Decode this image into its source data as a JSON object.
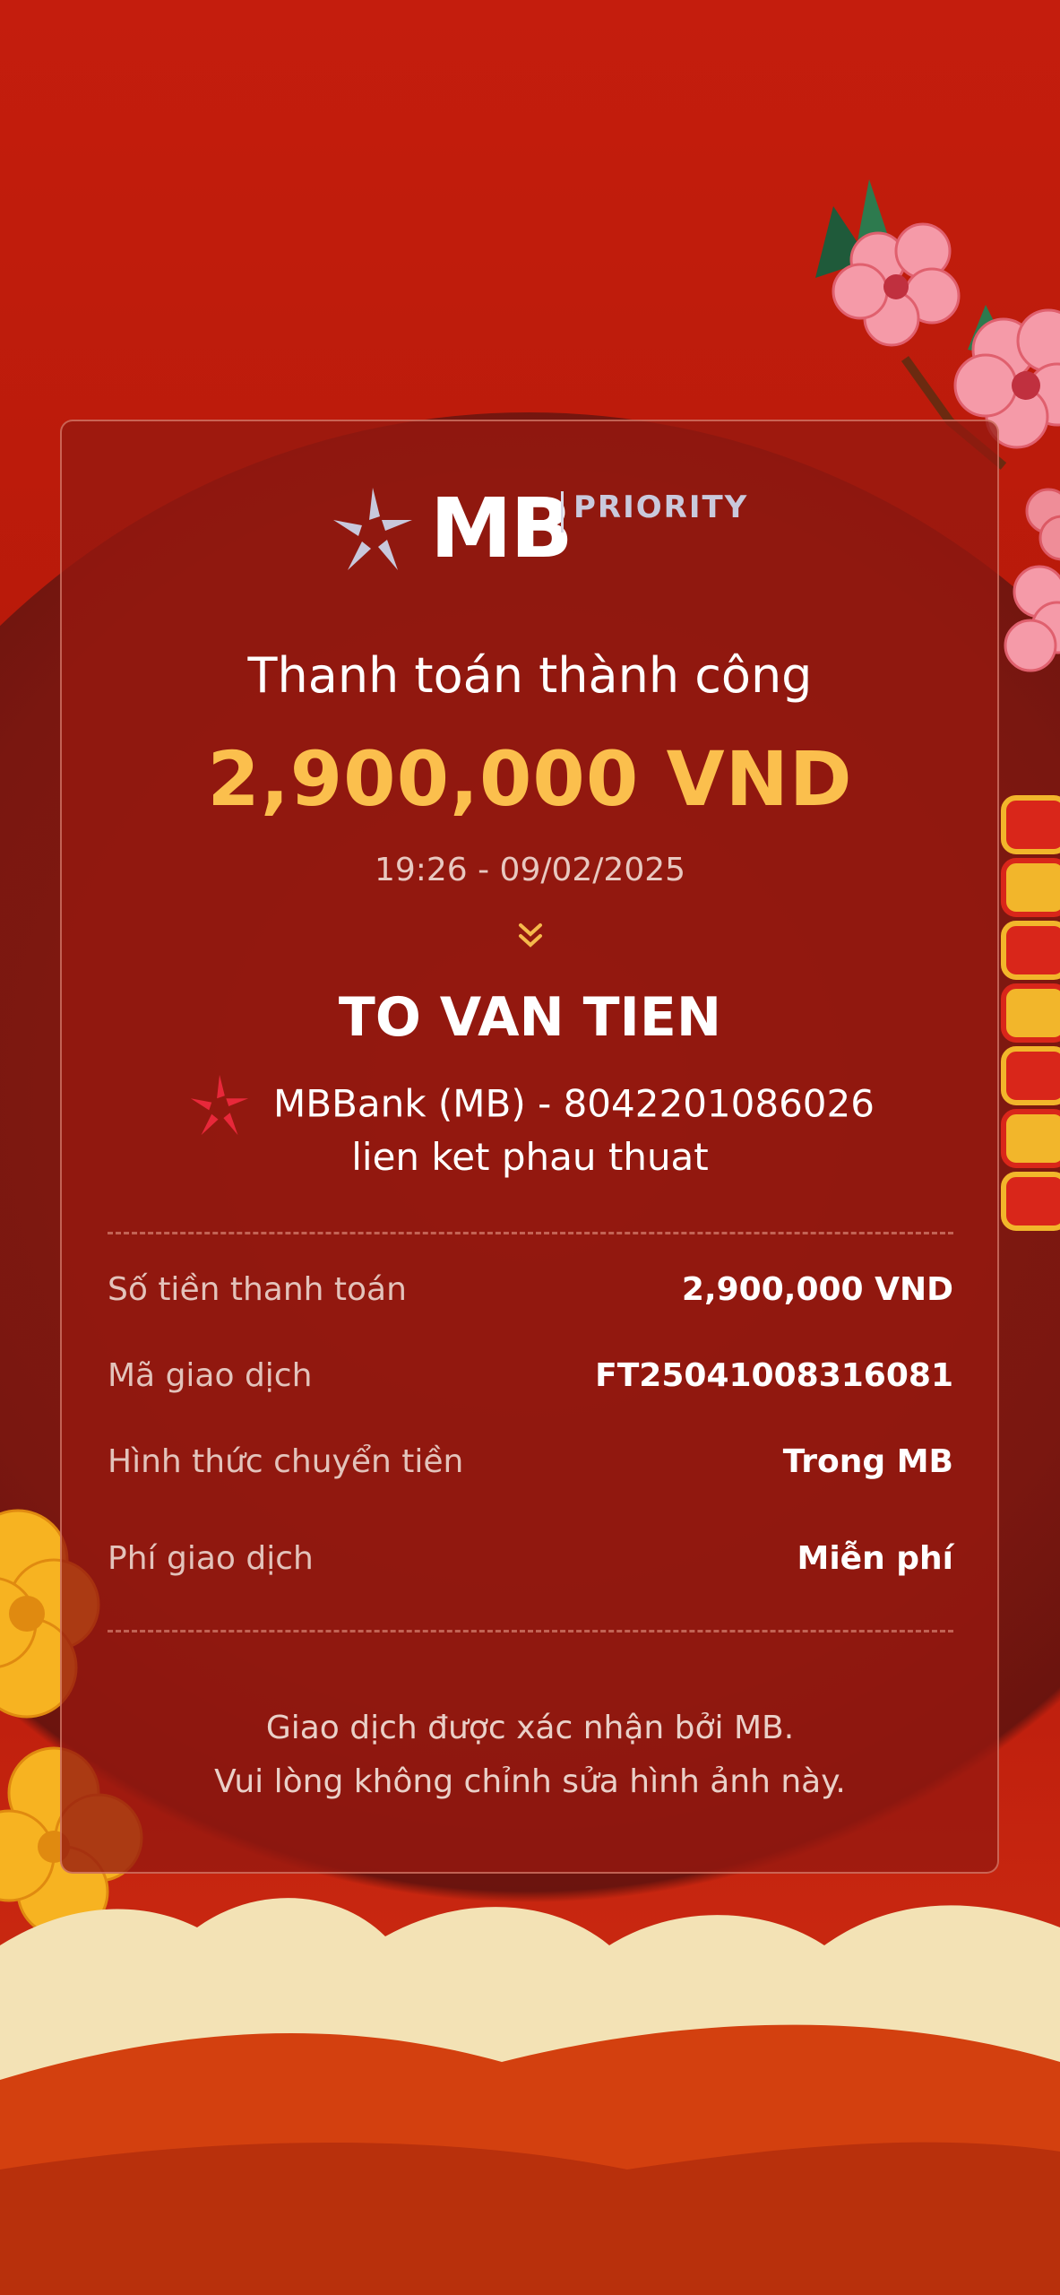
{
  "brand": {
    "logo_text": "MB",
    "tier": "PRIORITY"
  },
  "receipt": {
    "status_title": "Thanh toán thành công",
    "amount": "2,900,000 VND",
    "datetime": "19:26 - 09/02/2025",
    "recipient_name": "TO VAN TIEN",
    "recipient_bank": "MBBank (MB) - 8042201086026",
    "memo": "lien ket phau thuat"
  },
  "details": [
    {
      "label": "Số tiền thanh toán",
      "value": "2,900,000 VND"
    },
    {
      "label": "Mã giao dịch",
      "value": "FT25041008316081"
    },
    {
      "label": "Hình thức chuyển tiền",
      "value": "Trong MB"
    },
    {
      "label": "Phí giao dịch",
      "value": "Miễn phí"
    }
  ],
  "footer": {
    "line1": "Giao dịch được xác nhận bởi MB.",
    "line2": "Vui lòng không chỉnh sửa hình ảnh này."
  },
  "colors": {
    "background": "#c41d0d",
    "card": "#96180f",
    "amount": "#fbbf4d",
    "text": "#ffffff"
  }
}
